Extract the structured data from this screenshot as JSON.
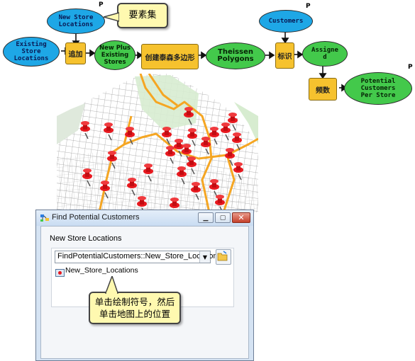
{
  "model": {
    "new_store_locations": "New Store\nLocations",
    "existing_store_locations": "Existing\nStore\nLocations",
    "append_tool": "追加",
    "new_plus_existing": "New Plus\nExisting\nStores",
    "create_thiessen_tool": "创建泰森多边形",
    "thiessen_polygons": "Theissen\nPolygons",
    "customers": "Customers",
    "identity_tool": "标识",
    "assigned": "Assigne\nd",
    "frequency_tool": "频数",
    "potential_customers": "Potential\nCustomers\nPer Store",
    "parameter_tag": "P",
    "feature_set_callout": "要素集"
  },
  "dialog": {
    "title": "Find Potential Customers",
    "section_label": "New Store Locations",
    "dropdown_value": "FindPotentialCustomers::New_Store_Locations",
    "tree_item": "New_Store_Locations",
    "callout": "单击绘制符号，然后\n单击地图上的位置"
  },
  "colors": {
    "data_ellipse": "#1ea7e6",
    "derived_ellipse": "#43c94b",
    "tool_box": "#f6c22e",
    "callout": "#fff9b0",
    "pushpin": "#e8191f",
    "road": "#f5a623"
  }
}
